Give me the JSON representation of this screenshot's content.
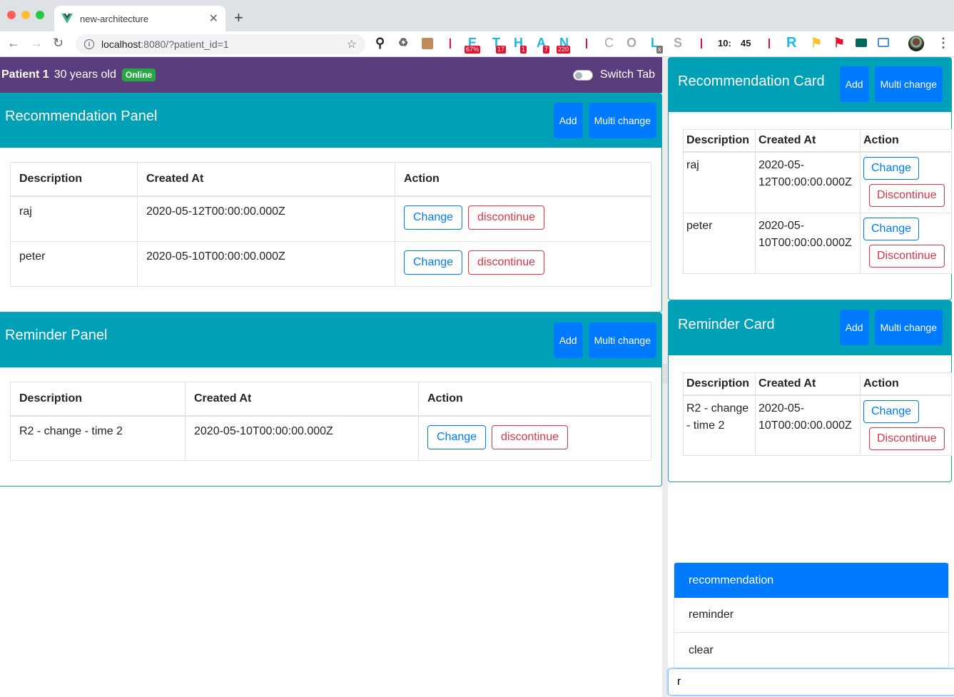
{
  "browser": {
    "tab_title": "new-architecture",
    "url_host": "localhost",
    "url_rest": ":8080/?patient_id=1",
    "extensions": {
      "letters": [
        "E",
        "T",
        "H",
        "A",
        "N",
        "C",
        "O",
        "L",
        "S",
        "R"
      ],
      "badges": [
        "67%",
        "17",
        "1",
        "7",
        "220"
      ],
      "l_badge": "x",
      "clock_hours": "10:",
      "clock_minutes": "45"
    }
  },
  "patient": {
    "name": "Patient 1",
    "age": "30 years old",
    "status": "Online",
    "switch_label": "Switch Tab"
  },
  "panels": [
    {
      "title": "Recommendation Panel",
      "add_label": "Add",
      "multi_label": "Multi change",
      "columns": [
        "Description",
        "Created At",
        "Action"
      ],
      "rows": [
        {
          "description": "raj",
          "created_at": "2020-05-12T00:00:00.000Z",
          "change": "Change",
          "discontinue": "discontinue"
        },
        {
          "description": "peter",
          "created_at": "2020-05-10T00:00:00.000Z",
          "change": "Change",
          "discontinue": "discontinue"
        }
      ]
    },
    {
      "title": "Reminder Panel",
      "add_label": "Add",
      "multi_label": "Multi change",
      "columns": [
        "Description",
        "Created At",
        "Action"
      ],
      "rows": [
        {
          "description": "R2 - change - time 2",
          "created_at": "2020-05-10T00:00:00.000Z",
          "change": "Change",
          "discontinue": "discontinue"
        }
      ]
    }
  ],
  "cards": [
    {
      "title": "Recommendation Card",
      "add_label": "Add",
      "multi_label": "Multi change",
      "columns": [
        "Description",
        "Created At",
        "Action"
      ],
      "rows": [
        {
          "description": "raj",
          "created_at": "2020-05-12T00:00:00.000Z",
          "change": "Change",
          "discontinue": "Discontinue"
        },
        {
          "description": "peter",
          "created_at": "2020-05-10T00:00:00.000Z",
          "change": "Change",
          "discontinue": "Discontinue"
        }
      ]
    },
    {
      "title": "Reminder Card",
      "add_label": "Add",
      "multi_label": "Multi change",
      "columns": [
        "Description",
        "Created At",
        "Action"
      ],
      "rows": [
        {
          "description": "R2 - change - time 2",
          "created_at": "2020-05-10T00:00:00.000Z",
          "change": "Change",
          "discontinue": "Discontinue"
        }
      ]
    }
  ],
  "suggestions": {
    "items": [
      "recommendation",
      "reminder",
      "clear"
    ],
    "active_index": 0
  },
  "chat_input": {
    "value": "r"
  },
  "colors": {
    "patient_bar": "#5a3d7c",
    "panel_header": "#00a1b7",
    "primary": "#007bff",
    "danger": "#dc3545",
    "success": "#28a745"
  }
}
